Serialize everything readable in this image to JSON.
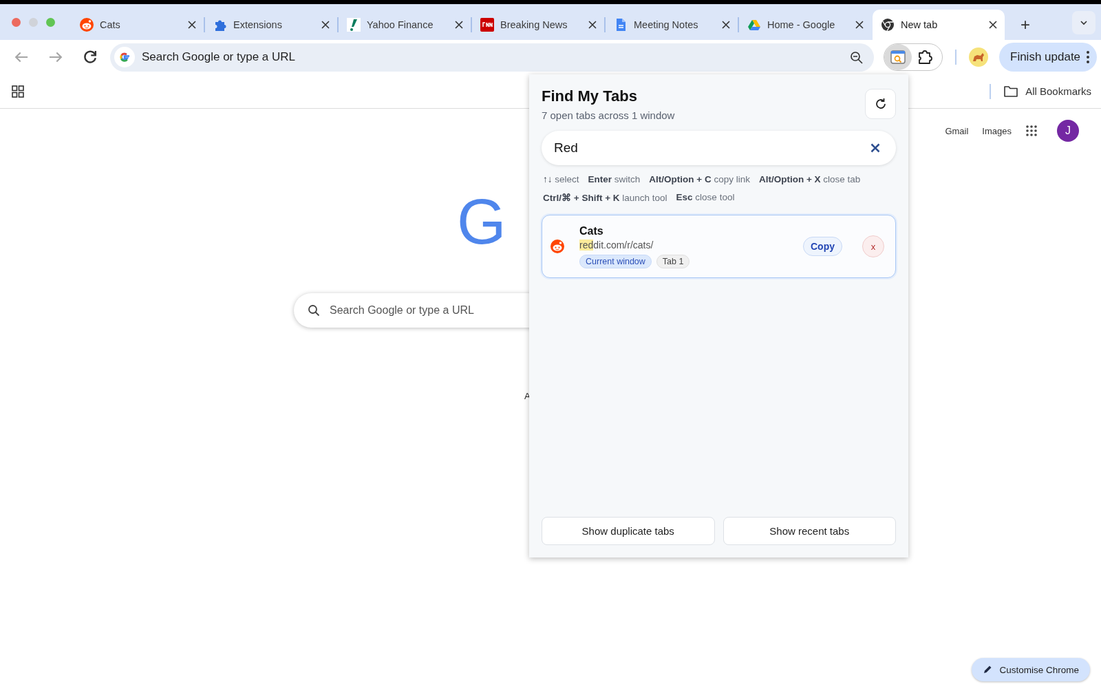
{
  "tabs": [
    {
      "title": "Cats",
      "kind": "reddit",
      "selected": false
    },
    {
      "title": "Extensions",
      "kind": "puzzle",
      "selected": false
    },
    {
      "title": "Yahoo Finance",
      "kind": "finance",
      "selected": false
    },
    {
      "title": "Breaking News",
      "kind": "news",
      "selected": false
    },
    {
      "title": "Meeting Notes",
      "kind": "doc",
      "selected": false
    },
    {
      "title": "Home - Google",
      "kind": "drive",
      "selected": false
    },
    {
      "title": "New tab",
      "kind": "chrome",
      "selected": true
    }
  ],
  "new_tab_button": "+",
  "nav_buttons": [
    {
      "kind": "back",
      "disabled": true
    },
    {
      "kind": "forward",
      "disabled": true
    },
    {
      "kind": "reload",
      "disabled": false
    }
  ],
  "address_bar": {
    "placeholder": "Search Google or type a URL"
  },
  "update_button": "Finish update",
  "bookmarks_bar": {
    "all_bookmarks": "All Bookmarks"
  },
  "page": {
    "links": [
      "Gmail",
      "Images"
    ],
    "account_initial": "J",
    "logo_letters": [
      {
        "char": "G",
        "color": "#4f86ec"
      }
    ],
    "search": {
      "placeholder": "Search Google or type a URL"
    },
    "fragment": "A",
    "customise_button": "Customise Chrome"
  },
  "popup": {
    "title": "Find My Tabs",
    "subtitle": "7 open tabs across 1 window",
    "search": {
      "value": "Red"
    },
    "hints": [
      {
        "key": "↑↓",
        "action": "select"
      },
      {
        "key": "Enter",
        "action": "switch"
      },
      {
        "key": "Alt/Option + C",
        "action": "copy link"
      },
      {
        "key": "Alt/Option + X",
        "action": "close tab"
      },
      {
        "key": "Ctrl/⌘ + Shift + K",
        "action": "launch tool"
      },
      {
        "key": "Esc",
        "action": "close tool"
      }
    ],
    "results": [
      {
        "title": "Cats",
        "kind": "reddit",
        "selected": true,
        "url_parts": [
          {
            "text": "red",
            "highlighted": true
          },
          {
            "text": "dit.com/r/cats/",
            "highlighted": false
          }
        ],
        "chips": [
          {
            "label": "Current window",
            "kind": "window"
          },
          {
            "label": "Tab 1",
            "kind": "index"
          }
        ],
        "copy_button": "Copy",
        "close_button": "x"
      }
    ],
    "footer_buttons": [
      "Show duplicate tabs",
      "Show recent tabs"
    ]
  }
}
